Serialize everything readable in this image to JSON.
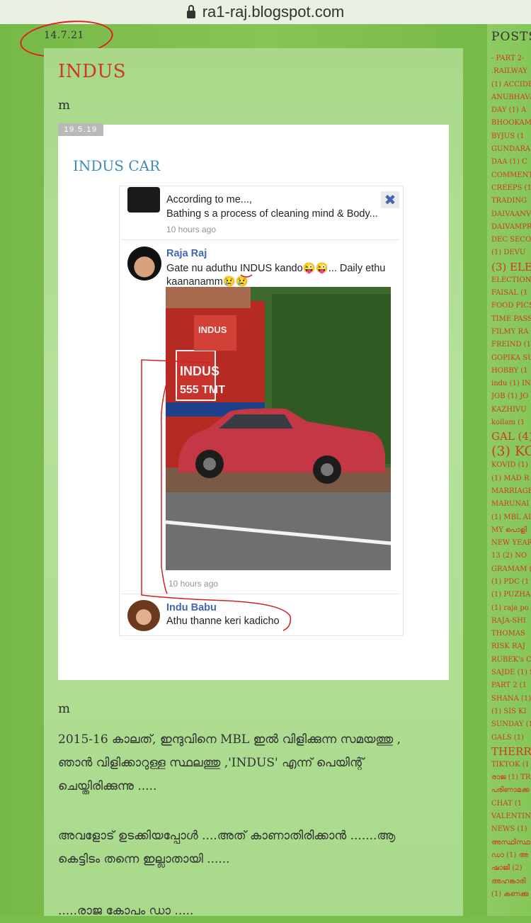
{
  "browser": {
    "url": "ra1-raj.blogspot.com"
  },
  "post": {
    "date_top": "14.7.21",
    "title": "INDUS",
    "m1": "m",
    "inner": {
      "date": "19.5.19",
      "title": "INDUS CAR"
    },
    "comments": [
      {
        "line1": "According to me...,",
        "line2": "Bathing s a process of cleaning mind & Body...",
        "time": "10 hours ago"
      },
      {
        "name": "Raja Raj",
        "line1": "Gate nu aduthu INDUS kando😜😜... Daily ethu",
        "line2": "kaananamm😢😢",
        "time": "10 hours ago"
      },
      {
        "name": "Indu Babu",
        "line1": "Athu thanne keri kadicho"
      }
    ],
    "m2": "m",
    "para1_l1": "2015-16 കാലത്, ഇന്ദുവിനെ  MBL ഇൽ വിളിക്കുന്ന സമയത്തു ,",
    "para1_l2": "ഞാൻ  വിളിക്കാറുള്ള സ്ഥലത്തു  ,'INDUS' എന്ന് പെയിന്റ്",
    "para1_l3": "ചെയ്തിരിക്കുന്നു .....",
    "para2_l1": "അവളോട്  ഉടക്കിയപ്പോൾ ....അത്  കാണാതിരിക്കാൻ .......ആ",
    "para2_l2": "കെട്ടിടം  തന്നെ  ഇല്ലാതായി ......",
    "para3_l1": ".....രാജ  കോപം  ഡാ ....."
  },
  "sidebar": {
    "title": "POSTS",
    "items": [
      "- PART 2-",
      ".RAILWAY",
      "(1) ACCIDE",
      "ANUBHAVA",
      "DAY (1) A",
      "BHOOKAM",
      "BYJUS (1",
      "GUNDARA",
      "DAA (1) C",
      "COMMENT",
      "CREEPS (1",
      "TRADING",
      "DAIVAANV",
      "DAIVAMPR",
      "DEC SECO",
      "(1) DEVU",
      "(3) ELE",
      "ELECTION",
      "FAISAL (1",
      "FOOD PICS",
      "TIME PASS",
      "FILMY RA",
      "FREIND (1",
      "GOPIKA SU",
      "HOBBY (1",
      "indu (1) IN",
      "JOB (1) JO",
      "KAZHIVU",
      "kollam (1",
      "GAL (4)",
      "(3) KO",
      "KOVID (1)",
      "(1) MAD R",
      "MARRIAGE",
      "MARUNAI",
      "(1) MBL AI",
      "MY പൊളി",
      "NEW YEAR",
      "13 (2) NO",
      "GRAMAM (",
      "(1) PDC (1",
      "(1) PUZHA",
      "(1) raja po",
      "RAJA-SHI",
      "THOMAS",
      "RISK RAJ",
      "RUBEK's C",
      "SAJDE (1) S",
      "PART 2 (1",
      "SHANA (1)",
      "(1) SIS KI",
      "SUNDAY (1",
      "GALS (1)",
      "THERRY",
      "TIKTOK (1",
      "രാജ (1) TR",
      "പരിണാമക്ക",
      "CHAT (1",
      "VALENTIN",
      "NEWS (1)",
      "അസ്ഥിസ്ഥാ",
      "ഡാ (1) അ",
      "ഷാജി (2)",
      "അഹങ്കാരി",
      "(1) കണക്കു"
    ]
  }
}
